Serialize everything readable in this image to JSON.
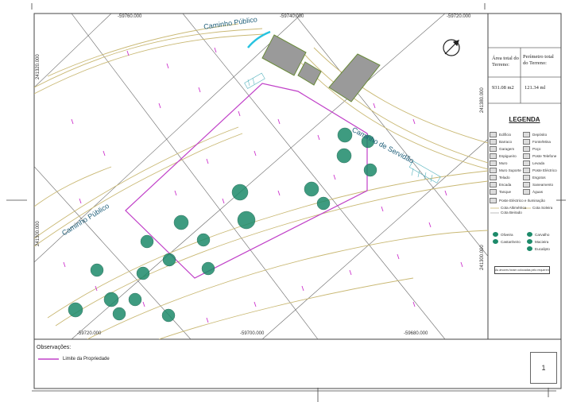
{
  "coords": {
    "top": [
      "-59760.000",
      "-59740.000",
      "-59720.000"
    ],
    "bottom": [
      "-59720.000",
      "-59700.000",
      "-59680.000"
    ],
    "left": [
      "241320.000",
      "241300.000"
    ],
    "right": [
      "241300.000",
      "241380.000"
    ]
  },
  "roads": {
    "caminho_publico_top": "Caminho Público",
    "caminho_servidao": "Caminho de Servidão",
    "caminho_publico_left": "Caminho Público"
  },
  "info": {
    "area_label": "Área total do Terreno:",
    "perimetro_label": "Perímetro total do Terreno:",
    "area_value": "931.08 m2",
    "perimetro_value": "121.34 ml"
  },
  "legend": {
    "title": "LEGENDA",
    "items_left": [
      "Edifício",
      "Barraco",
      "Garagem",
      "Espigueiro",
      "Muro",
      "Muro Suporte",
      "Telado",
      "Escada",
      "Tanque"
    ],
    "items_right": [
      "Depósito",
      "Fonte/Mina",
      "Poço",
      "Poste Telefone",
      "Levada",
      "Poste Eléctrico",
      "Esgotos",
      "Saneamento",
      "Águas"
    ],
    "wide_items": [
      "Poste Eléctrico e Iluminação",
      "Cota Altimétrica",
      "Cota Soleira",
      "Cota Beirado"
    ],
    "trees": [
      "Oliveira",
      "Carvalho",
      "Castanheiro",
      "Macieira",
      "Eucalipto"
    ],
    "note": "As árvores foram colocadas pelo requerente"
  },
  "footer": {
    "observacoes": "Observações:",
    "limite": "Limite da Propriedade",
    "page": "1"
  },
  "colors": {
    "boundary": "#c040c8",
    "road": "#c9b873",
    "grid": "#555555",
    "tree": "#1d8a6a",
    "building": "#9a9a9a"
  }
}
